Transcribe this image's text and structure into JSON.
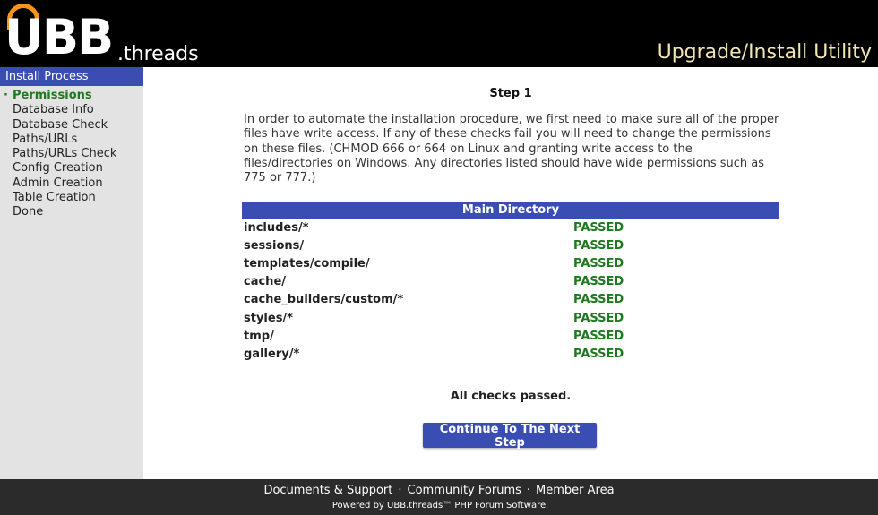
{
  "header": {
    "logo_main": "UBB",
    "logo_suffix": ".threads",
    "utility_title": "Upgrade/Install Utility"
  },
  "sidebar": {
    "title": "Install Process",
    "bullet": "·",
    "items": [
      {
        "label": "Permissions",
        "active": true
      },
      {
        "label": "Database Info",
        "active": false
      },
      {
        "label": "Database Check",
        "active": false
      },
      {
        "label": "Paths/URLs",
        "active": false
      },
      {
        "label": "Paths/URLs Check",
        "active": false
      },
      {
        "label": "Config Creation",
        "active": false
      },
      {
        "label": "Admin Creation",
        "active": false
      },
      {
        "label": "Table Creation",
        "active": false
      },
      {
        "label": "Done",
        "active": false
      }
    ]
  },
  "main": {
    "step_title": "Step 1",
    "intro": "In order to automate the installation procedure, we first need to make sure all of the proper files have write access. If any of these checks fail you will need to change the permissions on these files. (CHMOD 666 or 664 on Linux and granting write access to the files/directories on Windows. Any directories listed should have wide permissions such as 775 or 777.)",
    "table_header": "Main Directory",
    "rows": [
      {
        "path": "includes/*",
        "status": "PASSED"
      },
      {
        "path": "sessions/",
        "status": "PASSED"
      },
      {
        "path": "templates/compile/",
        "status": "PASSED"
      },
      {
        "path": "cache/",
        "status": "PASSED"
      },
      {
        "path": "cache_builders/custom/*",
        "status": "PASSED"
      },
      {
        "path": "styles/*",
        "status": "PASSED"
      },
      {
        "path": "tmp/",
        "status": "PASSED"
      },
      {
        "path": "gallery/*",
        "status": "PASSED"
      }
    ],
    "summary": "All checks passed.",
    "continue_label": "Continue To The Next Step"
  },
  "footer": {
    "links": [
      "Documents & Support",
      "Community Forums",
      "Member Area"
    ],
    "separator": "·",
    "powered_by": "Powered by UBB.threads™ PHP Forum Software"
  },
  "colors": {
    "accent_blue": "#3a4db3",
    "passed_green": "#1e7a1e",
    "logo_orange": "#f7941d",
    "header_bg": "#000000",
    "footer_bg": "#2b2b2b",
    "sidebar_bg": "#e3e3e3"
  }
}
